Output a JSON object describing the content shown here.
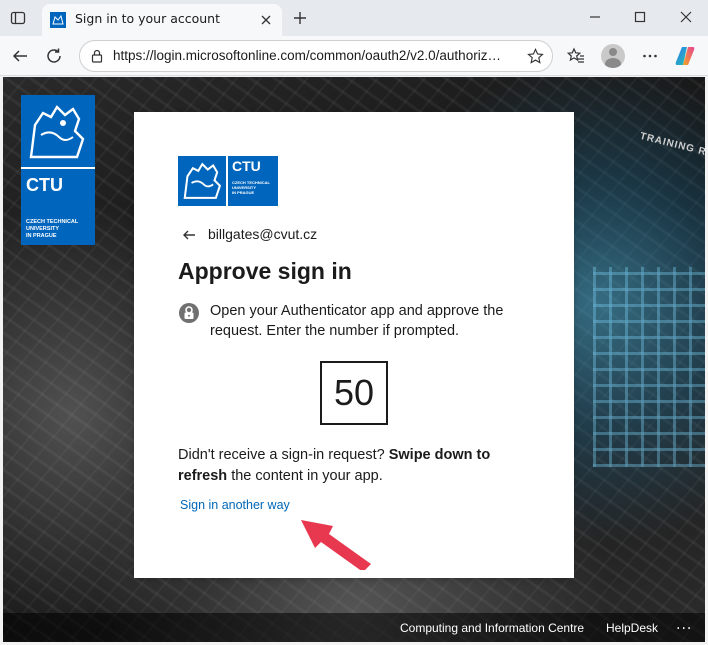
{
  "browser": {
    "tab_title": "Sign in to your account",
    "url": "https://login.microsoftonline.com/common/oauth2/v2.0/authorize?client_id=...",
    "icons": [
      "tab-actions-icon",
      "favicon-icon",
      "close-tab-icon",
      "new-tab-icon",
      "minimize-icon",
      "maximize-icon",
      "close-window-icon",
      "back-icon",
      "refresh-icon",
      "lock-icon",
      "favorite-star-icon",
      "favorites-icon",
      "profile-icon",
      "settings-more-icon",
      "copilot-icon"
    ]
  },
  "background": {
    "training_text": "TRAINING R"
  },
  "brand_logo": {
    "name": "CTU",
    "subtitle": "CZECH TECHNICAL\nUNIVERSITY\nIN PRAGUE",
    "color": "#0065bd"
  },
  "card": {
    "identity": "billgates@cvut.cz",
    "title": "Approve sign in",
    "instructions": "Open your Authenticator app and approve the request. Enter the number if prompted.",
    "number": "50",
    "help_prefix": "Didn't receive a sign-in request? ",
    "help_bold": "Swipe down to refresh",
    "help_suffix": " the content in your app.",
    "alt_link": "Sign in another way",
    "link_color": "#0067b8"
  },
  "annotation": {
    "arrow_color": "#e8384f"
  },
  "footer": {
    "link1": "Computing and Information Centre",
    "link2": "HelpDesk",
    "more": "..."
  }
}
